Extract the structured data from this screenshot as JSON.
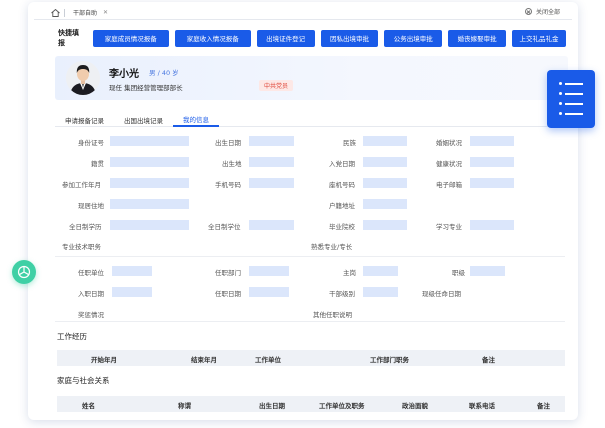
{
  "topbar": {
    "tab_label": "干部自助",
    "close_all": "关闭全部"
  },
  "quick": {
    "label": "快捷填报",
    "buttons": [
      "家庭成员情况报备",
      "家庭收入情况报备",
      "出境证件登记",
      "因私出境审批",
      "公务出境审批",
      "婚丧嫁娶审批",
      "上交礼品礼金"
    ]
  },
  "profile": {
    "name": "李小光",
    "meta": "男 / 40 岁",
    "position": "现任  集团经营管理部部长",
    "badge": "中共党员"
  },
  "subtabs": [
    "申请报备记录",
    "出国出境记录",
    "我的信息"
  ],
  "form": {
    "id_no": "身份证号",
    "birth": "出生日期",
    "ethnic": "民族",
    "marital": "婚姻状况",
    "native": "籍贯",
    "birthplace": "出生地",
    "party_date": "入党日期",
    "health": "健康状况",
    "work_date": "参加工作年月",
    "mobile": "手机号码",
    "landline": "座机号码",
    "email": "电子邮箱",
    "residence": "现居住地",
    "household": "户籍地址",
    "ft_edu": "全日制学历",
    "ft_degree": "全日制学位",
    "school": "毕业院校",
    "major": "学习专业",
    "tech_title": "专业技术职务",
    "skills": "熟悉专业/专长",
    "unit": "任职单位",
    "dept": "任职部门",
    "post": "主岗",
    "rank": "职级",
    "entry_date": "入职日期",
    "appoint_date": "任职日期",
    "cadre_level": "干部级别",
    "level_date": "现级任命日期",
    "rewards": "奖惩情况",
    "other_notes": "其他任职说明"
  },
  "work_section": {
    "title": "工作经历",
    "headers": [
      "开始年月",
      "结束年月",
      "工作单位",
      "工作部门职务",
      "备注"
    ]
  },
  "family_section": {
    "title": "家庭与社会关系",
    "headers": [
      "姓名",
      "称谓",
      "出生日期",
      "工作单位及职务",
      "政治面貌",
      "联系电话",
      "备注"
    ]
  },
  "colors": {
    "primary": "#1a5be8",
    "field": "#dbe6fb",
    "badge_text": "#e0483a",
    "float_green": "#3fd0a5"
  }
}
